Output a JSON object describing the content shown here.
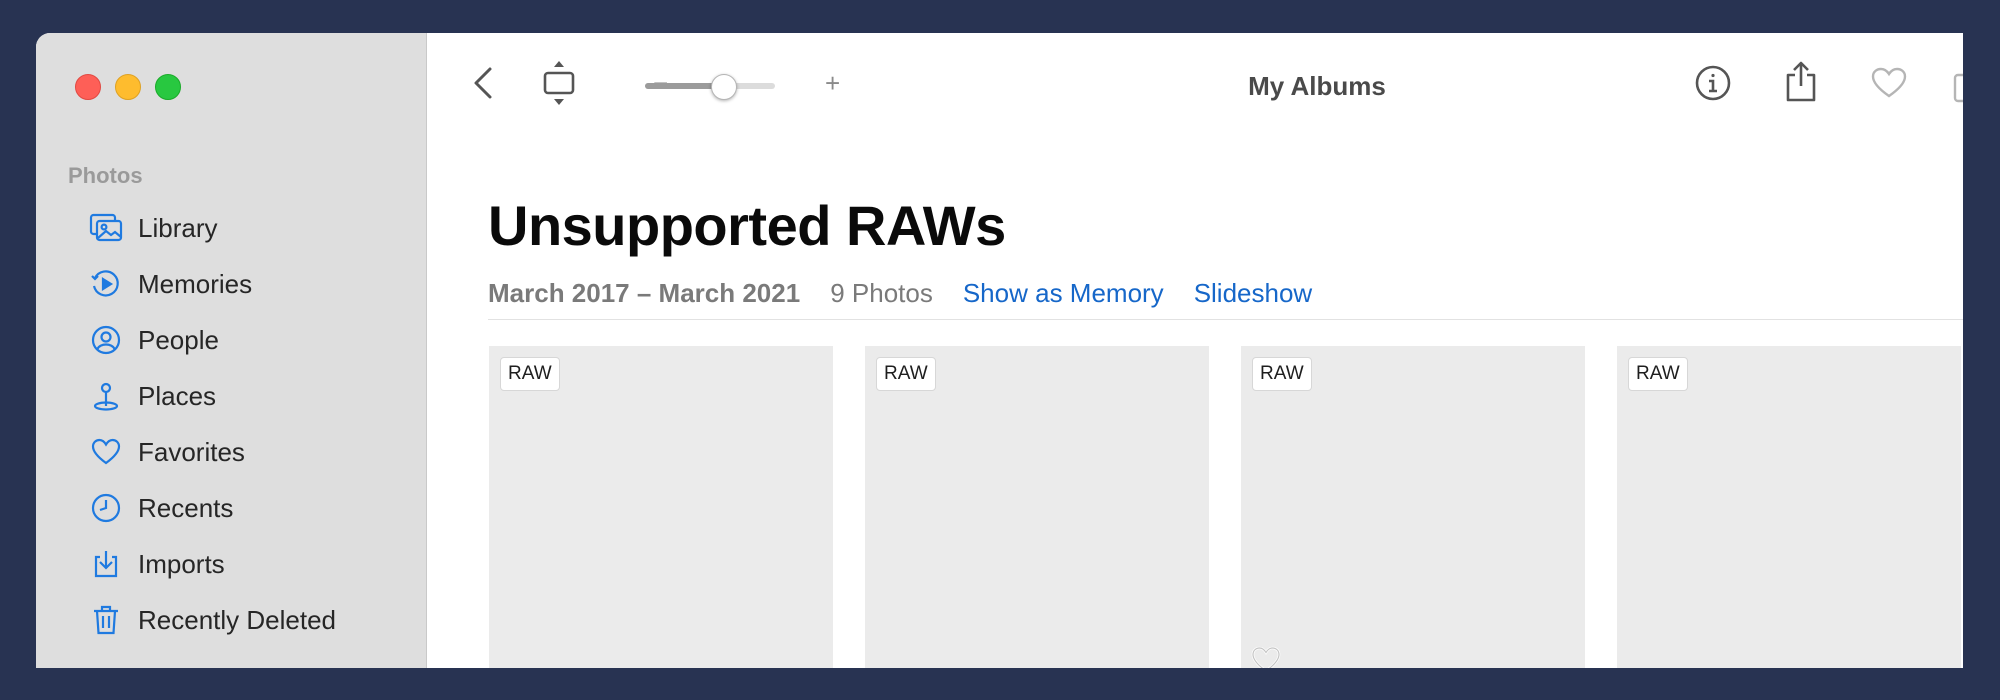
{
  "window": {
    "title": "My Albums"
  },
  "sidebar": {
    "section": "Photos",
    "items": [
      {
        "label": "Library",
        "icon": "library-icon"
      },
      {
        "label": "Memories",
        "icon": "memories-icon"
      },
      {
        "label": "People",
        "icon": "people-icon"
      },
      {
        "label": "Places",
        "icon": "places-icon"
      },
      {
        "label": "Favorites",
        "icon": "favorites-icon"
      },
      {
        "label": "Recents",
        "icon": "recents-icon"
      },
      {
        "label": "Imports",
        "icon": "imports-icon"
      },
      {
        "label": "Recently Deleted",
        "icon": "trash-icon"
      }
    ]
  },
  "toolbar": {
    "zoom_minus": "−",
    "zoom_plus": "+",
    "zoom_level": 0.6
  },
  "album": {
    "title": "Unsupported RAWs",
    "date_range": "March 2017 – March 2021",
    "photo_count": "9 Photos",
    "show_as_memory": "Show as Memory",
    "slideshow": "Slideshow"
  },
  "photos": [
    {
      "badge": "RAW",
      "favorite": false
    },
    {
      "badge": "RAW",
      "favorite": false
    },
    {
      "badge": "RAW",
      "favorite": true
    },
    {
      "badge": "RAW",
      "favorite": false
    }
  ],
  "colors": {
    "accent": "#1667c9",
    "sidebar_icon": "#1f7ae0",
    "traffic_red": "#fe5f57",
    "traffic_yellow": "#febc2e",
    "traffic_green": "#28c840"
  }
}
